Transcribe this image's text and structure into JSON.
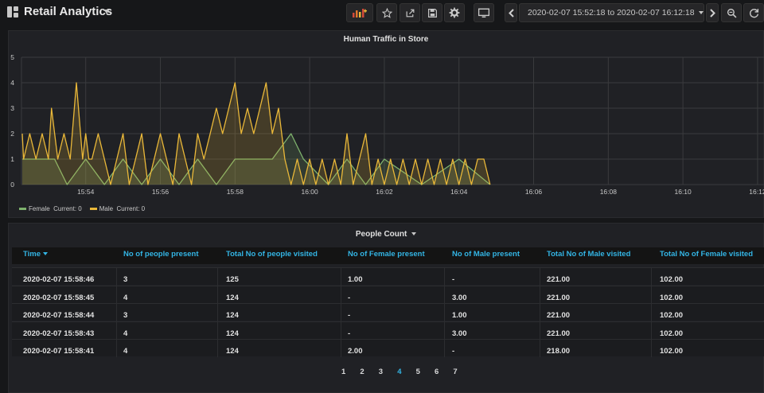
{
  "header": {
    "title": "Retail Analytics",
    "time_range": "2020-02-07 15:52:18 to 2020-02-07 16:12:18"
  },
  "toolbar": {
    "icons": [
      "add-panel-icon",
      "star-icon",
      "share-icon",
      "save-icon",
      "gear-icon",
      "tv-mode-icon",
      "clock-icon",
      "chevron-left-icon",
      "chevron-right-icon",
      "zoom-out-icon",
      "refresh-icon"
    ]
  },
  "graph_panel": {
    "title": "Human Traffic in Store",
    "legend": [
      {
        "name": "Female",
        "current": "Current: 0",
        "color": "#7eb26d"
      },
      {
        "name": "Male",
        "current": "Current: 0",
        "color": "#eab839"
      }
    ]
  },
  "chart_data": {
    "type": "line",
    "y_ticks": [
      "0",
      "1",
      "2",
      "3",
      "4",
      "5"
    ],
    "x_ticks": [
      "15:54",
      "15:56",
      "15:58",
      "16:00",
      "16:02",
      "16:04",
      "16:06",
      "16:08",
      "16:10",
      "16:12"
    ],
    "ylim": [
      0,
      5
    ],
    "grid": true,
    "legend_position": "bottom-left",
    "series": [
      {
        "name": "Female",
        "color": "#7eb26d",
        "x": [
          "15:52:18",
          "15:53:00",
          "15:53:10",
          "15:53:30",
          "15:54:00",
          "15:54:30",
          "15:55:00",
          "15:55:30",
          "15:56:00",
          "15:56:30",
          "15:57:00",
          "15:57:30",
          "15:58:00",
          "15:58:30",
          "15:59:00",
          "15:59:30",
          "15:59:50",
          "16:00:30",
          "16:01:00",
          "16:01:30",
          "16:02:00",
          "16:03:00",
          "16:04:00",
          "16:04:50"
        ],
        "values": [
          1,
          1,
          1,
          0,
          1,
          0,
          1,
          0,
          1,
          0,
          1,
          0,
          1,
          1,
          1,
          2,
          1,
          0,
          1,
          0,
          1,
          0,
          1,
          0
        ]
      },
      {
        "name": "Male",
        "color": "#eab839",
        "x": [
          "15:52:18",
          "15:52:20",
          "15:52:30",
          "15:52:40",
          "15:52:50",
          "15:53:00",
          "15:53:05",
          "15:53:15",
          "15:53:25",
          "15:53:35",
          "15:53:45",
          "15:53:55",
          "15:54:00",
          "15:54:05",
          "15:54:10",
          "15:54:20",
          "15:54:30",
          "15:54:40",
          "15:54:50",
          "15:55:00",
          "15:55:10",
          "15:55:20",
          "15:55:30",
          "15:55:40",
          "15:55:50",
          "15:56:00",
          "15:56:10",
          "15:56:20",
          "15:56:30",
          "15:56:40",
          "15:56:50",
          "15:57:00",
          "15:57:10",
          "15:57:20",
          "15:57:30",
          "15:57:40",
          "15:57:50",
          "15:58:00",
          "15:58:10",
          "15:58:20",
          "15:58:30",
          "15:58:40",
          "15:58:50",
          "15:59:00",
          "15:59:10",
          "15:59:20",
          "15:59:30",
          "15:59:40",
          "15:59:50",
          "16:00:00",
          "16:00:10",
          "16:00:20",
          "16:00:30",
          "16:00:40",
          "16:00:50",
          "16:01:00",
          "16:01:10",
          "16:01:20",
          "16:01:30",
          "16:01:40",
          "16:01:50",
          "16:02:00",
          "16:02:10",
          "16:02:20",
          "16:02:30",
          "16:02:40",
          "16:02:50",
          "16:03:00",
          "16:03:10",
          "16:03:20",
          "16:03:30",
          "16:03:40",
          "16:03:50",
          "16:04:00",
          "16:04:10",
          "16:04:20",
          "16:04:30",
          "16:04:40",
          "16:04:50"
        ],
        "values": [
          2,
          1,
          2,
          1,
          2,
          1,
          3,
          1,
          2,
          1,
          4,
          1,
          2,
          1,
          1,
          2,
          1,
          0,
          1,
          2,
          0,
          1,
          2,
          0,
          1,
          2,
          1,
          0,
          2,
          1,
          0,
          2,
          1,
          2,
          3,
          2,
          3,
          4,
          2,
          3,
          2,
          3,
          4,
          2,
          3,
          1,
          0,
          1,
          0,
          1,
          0,
          1,
          0,
          1,
          0,
          2,
          0,
          1,
          2,
          0,
          1,
          0,
          1,
          0,
          1,
          0,
          1,
          0,
          1,
          0,
          1,
          0,
          1,
          0,
          1,
          0,
          1,
          1,
          0
        ]
      }
    ]
  },
  "table_panel": {
    "title": "People Count",
    "columns": [
      "Time",
      "No of people present",
      "Total No of people visited",
      "No of Female present",
      "No of Male present",
      "Total No of Male visited",
      "Total No of Female visited"
    ],
    "rows": [
      [
        "2020-02-07 15:58:46",
        "3",
        "125",
        "1.00",
        "-",
        "221.00",
        "102.00"
      ],
      [
        "2020-02-07 15:58:45",
        "4",
        "124",
        "-",
        "3.00",
        "221.00",
        "102.00"
      ],
      [
        "2020-02-07 15:58:44",
        "3",
        "124",
        "-",
        "1.00",
        "221.00",
        "102.00"
      ],
      [
        "2020-02-07 15:58:43",
        "4",
        "124",
        "-",
        "3.00",
        "221.00",
        "102.00"
      ],
      [
        "2020-02-07 15:58:41",
        "4",
        "124",
        "2.00",
        "-",
        "218.00",
        "102.00"
      ]
    ],
    "pages": [
      "1",
      "2",
      "3",
      "4",
      "5",
      "6",
      "7"
    ],
    "active_page": "4"
  }
}
